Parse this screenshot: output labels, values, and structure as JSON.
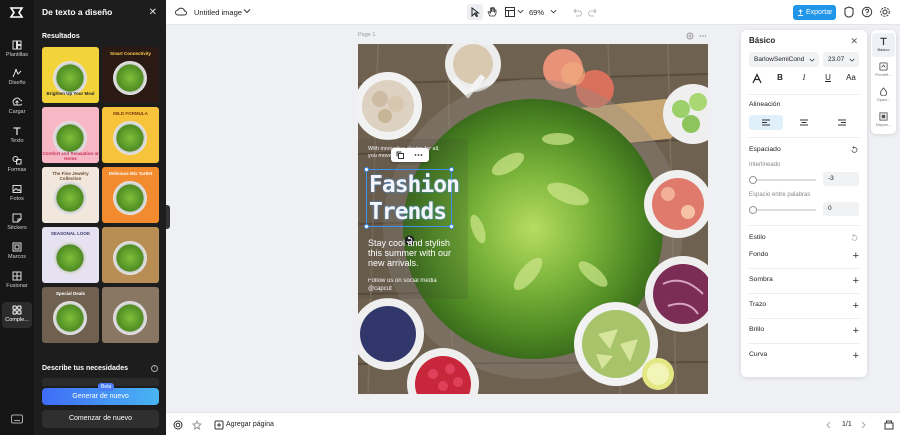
{
  "rail": {
    "items": [
      {
        "label": "Plantillas",
        "icon": "templates-icon"
      },
      {
        "label": "Diseño",
        "icon": "design-icon"
      },
      {
        "label": "Cargar",
        "icon": "upload-icon"
      },
      {
        "label": "Texto",
        "icon": "text-icon"
      },
      {
        "label": "Formas",
        "icon": "shapes-icon"
      },
      {
        "label": "Fotos",
        "icon": "photos-icon"
      },
      {
        "label": "Stickers",
        "icon": "stickers-icon"
      },
      {
        "label": "Marcos",
        "icon": "frames-icon"
      },
      {
        "label": "Fusionar",
        "icon": "merge-icon"
      },
      {
        "label": "Comple...",
        "icon": "plugins-icon"
      }
    ]
  },
  "left_panel": {
    "title": "De texto a diseño",
    "results_label": "Resultados",
    "thumbnails": [
      {
        "text": "Brighten Up Your Meal",
        "bg": "#f3d33a",
        "fg": "#2b2b2b"
      },
      {
        "text": "Smart Connectivity",
        "bg": "#2b1a14",
        "fg": "#ffcf4a"
      },
      {
        "text": "Comfort and Relaxation at Home",
        "bg": "#f8b7c4",
        "fg": "#c3325b"
      },
      {
        "text": "MILD FORMULA",
        "bg": "#f7c33b",
        "fg": "#7a3b10"
      },
      {
        "text": "The Fine Jewelry Collection",
        "bg": "#f1e7dc",
        "fg": "#6d4b2e"
      },
      {
        "text": "Delicious Mix Tartlet",
        "bg": "#f28a2e",
        "fg": "#ffffff"
      },
      {
        "text": "SEASONAL LOOK",
        "bg": "#e7e2f2",
        "fg": "#3a3a6a"
      },
      {
        "text": "",
        "bg": "#b98e55",
        "fg": "#ffffff"
      },
      {
        "text": "Special Deals",
        "bg": "#6f6050",
        "fg": "#ffffff"
      },
      {
        "text": "",
        "bg": "#8a7763",
        "fg": "#ffffff"
      }
    ],
    "needs_label": "Describe tus necesidades",
    "beta_badge": "Beta",
    "generate_button": "Generar de nuevo",
    "restart_button": "Comenzar de nuevo"
  },
  "topbar": {
    "doc_title": "Untitled image",
    "zoom": "69%",
    "export_button": "Exportar"
  },
  "canvas": {
    "page_label": "Page 1",
    "small_text": "With innovative design for all, you move...",
    "headline_1": "Fashion",
    "headline_2": "Trends",
    "body_text": "Stay cool and stylish this summer with our new arrivals.",
    "follow_text": "Follow us on social media @capcut"
  },
  "bottombar": {
    "add_page": "Agregar página",
    "page_counter": "1/1"
  },
  "properties": {
    "title": "Básico",
    "font_name": "BarlowSemiCond",
    "font_size": "23.07",
    "alignment_label": "Alineación",
    "spacing_label": "Espaciado",
    "line_spacing_label": "Interlineado",
    "line_spacing_value": "-3",
    "word_spacing_label": "Espacio entre palabras",
    "word_spacing_value": "0",
    "style_label": "Estilo",
    "background_label": "Fondo",
    "shadow_label": "Sombra",
    "stroke_label": "Trazo",
    "glow_label": "Brillo",
    "curve_label": "Curva"
  },
  "side_tabs": [
    {
      "label": "Básico",
      "icon": "text-basic-icon"
    },
    {
      "label": "Predeft...",
      "icon": "presets-icon"
    },
    {
      "label": "Opaci...",
      "icon": "opacity-icon"
    },
    {
      "label": "Dispos...",
      "icon": "arrange-icon"
    }
  ],
  "colors": {
    "accent": "#2196e9",
    "dark_bg": "#161616",
    "panel_bg": "#1d1d1d",
    "headline": "#f3f5f8"
  }
}
